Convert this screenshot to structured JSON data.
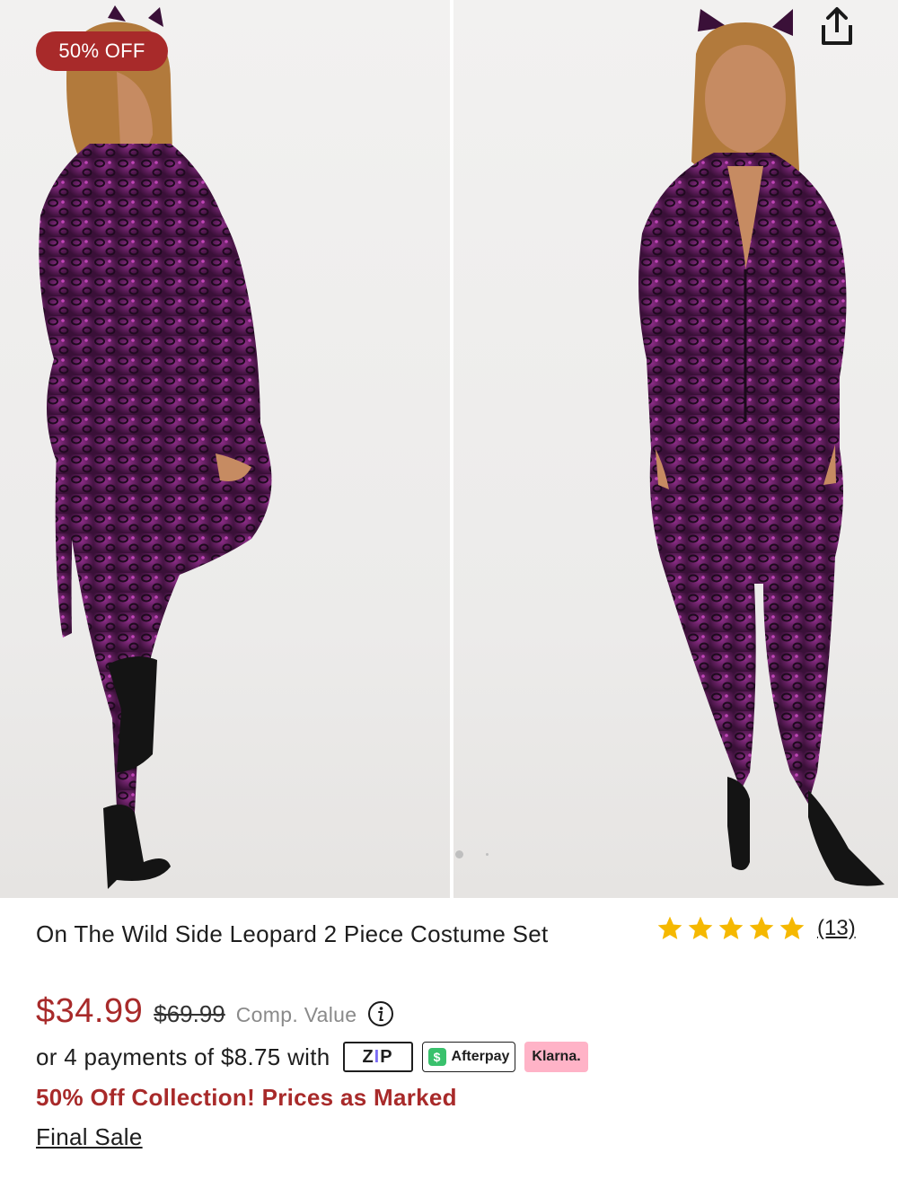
{
  "gallery": {
    "badge": "50% OFF",
    "images": [
      {
        "alt_icon": "model-back-view-image"
      },
      {
        "alt_icon": "model-front-view-image"
      }
    ],
    "pagination_active_index": 1,
    "share_icon": "share-icon"
  },
  "product": {
    "title": "On The Wild Side Leopard 2 Piece Costume Set",
    "rating_stars": 5,
    "review_count": "(13)",
    "price_now": "$34.99",
    "price_was": "$69.99",
    "comp_value_label": "Comp. Value",
    "payments_text": "or 4 payments of $8.75 with",
    "payment_providers": {
      "zip": {
        "z": "Z",
        "i": "I",
        "p": "P"
      },
      "afterpay": {
        "badge": "$",
        "label": "Afterpay"
      },
      "klarna": "Klarna."
    },
    "promo": "50% Off Collection! Prices as Marked",
    "final_sale": "Final Sale"
  },
  "colors": {
    "accent_red": "#a82a2a",
    "star_gold": "#f5b800",
    "costume_purple": "#5a1d5e"
  }
}
